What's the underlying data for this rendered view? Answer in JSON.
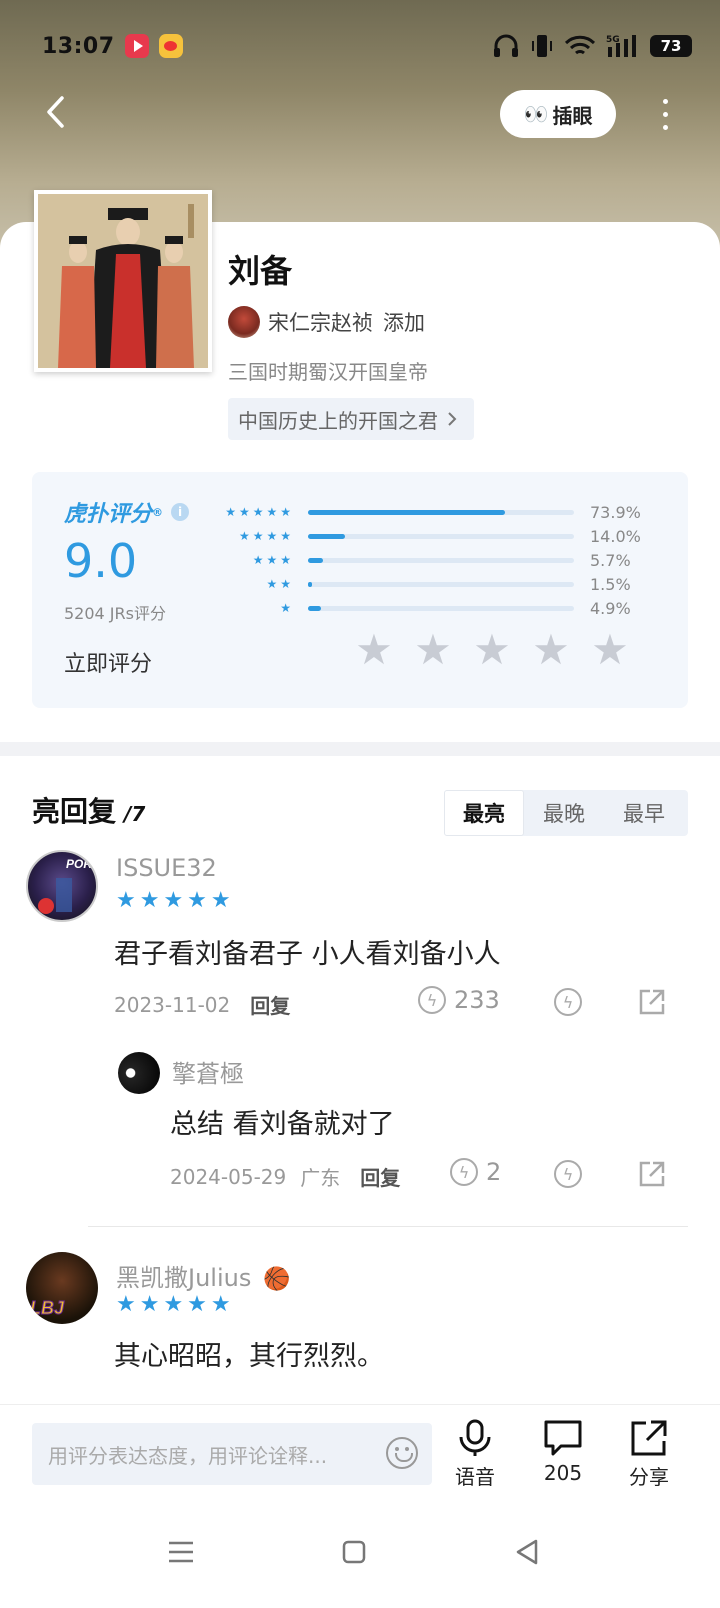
{
  "status_bar": {
    "time": "13:07",
    "battery": "73",
    "network": "5G"
  },
  "top_nav": {
    "chayan_label": "插眼",
    "chayan_emoji": "👀"
  },
  "header": {
    "title": "刘备",
    "added_by": "宋仁宗赵祯",
    "added_suffix": "添加",
    "subtitle": "三国时期蜀汉开国皇帝",
    "tag": "中国历史上的开国之君"
  },
  "rating": {
    "brand": "虎扑评分",
    "score": "9.0",
    "count": "5204 JRs评分",
    "rate_now": "立即评分",
    "distribution": [
      {
        "stars": 5,
        "pct": 73.9,
        "label": "73.9%"
      },
      {
        "stars": 4,
        "pct": 14.0,
        "label": "14.0%"
      },
      {
        "stars": 3,
        "pct": 5.7,
        "label": "5.7%"
      },
      {
        "stars": 2,
        "pct": 1.5,
        "label": "1.5%"
      },
      {
        "stars": 1,
        "pct": 4.9,
        "label": "4.9%"
      }
    ]
  },
  "highlights": {
    "title": "亮回复",
    "count": "/7",
    "tabs": [
      "最亮",
      "最晚",
      "最早"
    ],
    "active_tab": "最亮"
  },
  "comments": [
    {
      "user": "ISSUE32",
      "stars": 5,
      "text": "君子看刘备君子 小人看刘备小人",
      "date": "2023-11-02",
      "reply_label": "回复",
      "lights": "233",
      "reply": {
        "user": "擎蒼極",
        "text": "总结 看刘备就对了",
        "date": "2024-05-29",
        "location": "广东",
        "reply_label": "回复",
        "lights": "2"
      }
    },
    {
      "user": "黑凯撒Julius",
      "stars": 5,
      "text": "其心昭昭，其行烈烈。",
      "badge_emoji": "🏀"
    }
  ],
  "bottom_bar": {
    "placeholder": "用评分表达态度，用评论诠释...",
    "voice_label": "语音",
    "comment_count": "205",
    "share_label": "分享"
  },
  "colors": {
    "accent": "#2f9ae0",
    "star_empty": "#c8ccd4"
  }
}
